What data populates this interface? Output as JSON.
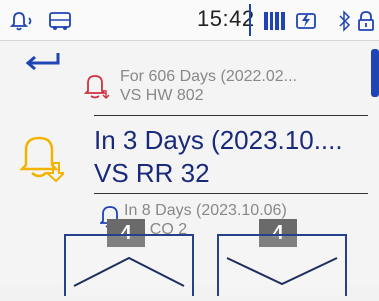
{
  "status_bar": {
    "time": "15:42",
    "icons": [
      "bell-speaker-icon",
      "bus-icon",
      "barcode-icon",
      "battery-charging-icon",
      "bluetooth-icon",
      "lock-icon"
    ]
  },
  "list": {
    "items": [
      {
        "line1": "For 606 Days (2022.02...",
        "line2": "VS HW 802",
        "icon": "bell-red-icon"
      },
      {
        "line1": "In 3 Days (2023.10....",
        "line2": "VS RR 32",
        "icon": "bell-yellow-icon",
        "selected": true
      },
      {
        "line1": "In 8 Days (2023.10.06)",
        "line2": "VS CO 2",
        "icon": "bell-blue-icon"
      }
    ]
  },
  "overlays": {
    "left_badge": "4",
    "right_badge": "4"
  },
  "colors": {
    "accent_blue": "#1f44b4",
    "alert_red": "#d03040",
    "alert_yellow": "#f2b400"
  }
}
